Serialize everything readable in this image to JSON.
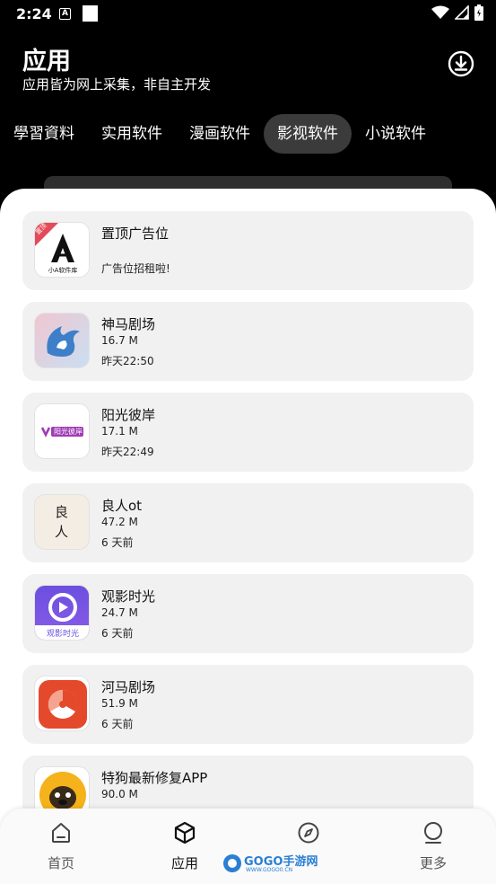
{
  "status": {
    "time": "2:24",
    "a_glyph": "A"
  },
  "header": {
    "title": "应用",
    "subtitle": "应用皆为网上采集，非自主开发"
  },
  "tabs": [
    {
      "label": "學習資料",
      "active": false
    },
    {
      "label": "实用软件",
      "active": false
    },
    {
      "label": "漫画软件",
      "active": false
    },
    {
      "label": "影视软件",
      "active": true
    },
    {
      "label": "小说软件",
      "active": false
    }
  ],
  "apps": [
    {
      "name": "置顶广告位",
      "size": "",
      "time": "广告位招租啦!",
      "badge": "置顶",
      "icon_caption": "小A软件库",
      "icon": "a-logo"
    },
    {
      "name": "神马剧场",
      "size": "16.7 M",
      "time": "昨天22:50",
      "icon": "shenma"
    },
    {
      "name": "阳光彼岸",
      "size": "17.1 M",
      "time": "昨天22:49",
      "icon": "yangguang",
      "icon_caption": "阳光彼岸"
    },
    {
      "name": "良人ot",
      "size": "47.2 M",
      "time": "6 天前",
      "icon": "liangren",
      "icon_caption": "良人"
    },
    {
      "name": "观影时光",
      "size": "24.7 M",
      "time": "6 天前",
      "icon": "guanying",
      "icon_caption": "观影时光"
    },
    {
      "name": "河马剧场",
      "size": "51.9 M",
      "time": "6 天前",
      "icon": "hema"
    },
    {
      "name": "特狗最新修复APP",
      "size": "90.0 M",
      "time": "",
      "icon": "tegou"
    }
  ],
  "nav": [
    {
      "label": "首页",
      "icon": "home-icon",
      "active": false
    },
    {
      "label": "应用",
      "icon": "cube-icon",
      "active": true
    },
    {
      "label": "",
      "icon": "compass-icon",
      "active": false
    },
    {
      "label": "更多",
      "icon": "more-icon",
      "active": false
    }
  ],
  "watermark": {
    "text": "GOGO手游网",
    "sub": "WWW.GOGO0.CN"
  },
  "colors": {
    "accent_blue": "#2a7fd4",
    "card_bg": "#f1f1f1",
    "header_bg": "#000000"
  }
}
